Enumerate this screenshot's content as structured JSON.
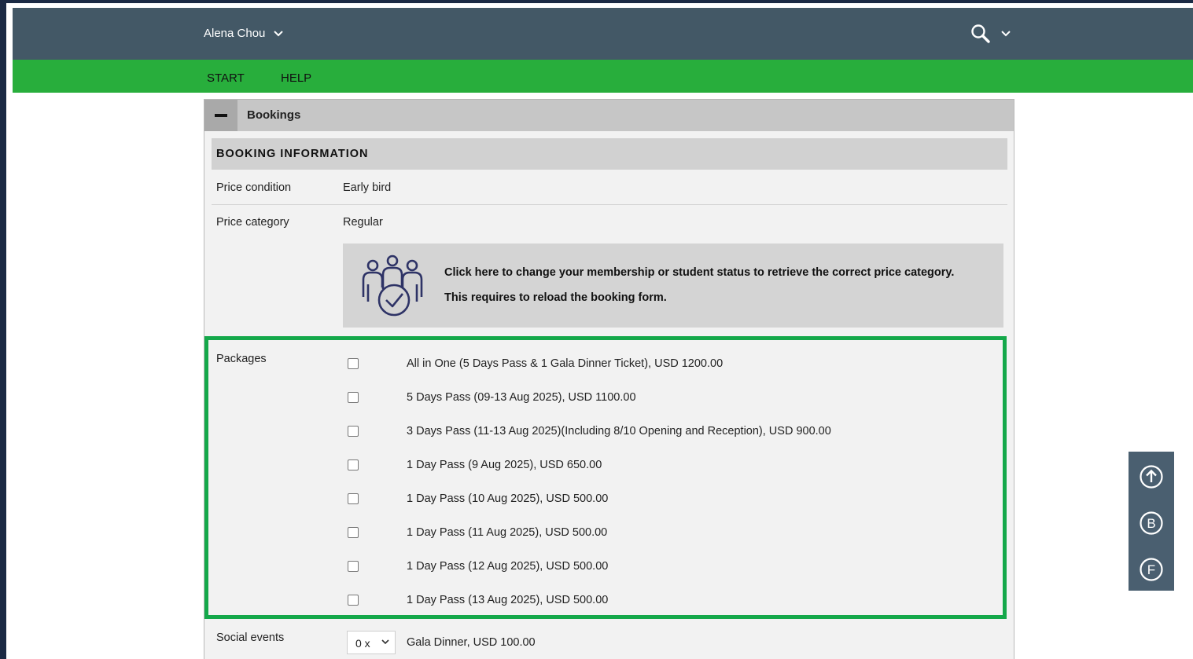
{
  "header": {
    "user_name": "Alena Chou",
    "user_dropdown_icon": "chevron-down-icon",
    "search_icon": "search-icon",
    "search_dropdown_icon": "chevron-down-icon"
  },
  "nav": {
    "items": [
      {
        "label": "START"
      },
      {
        "label": "HELP"
      }
    ]
  },
  "panel": {
    "title": "Bookings",
    "collapse_icon": "minus-icon",
    "section_title": "BOOKING INFORMATION",
    "price_condition": {
      "label": "Price condition",
      "value": "Early bird"
    },
    "price_category": {
      "label": "Price category",
      "value": "Regular"
    },
    "membership_notice": {
      "icon": "group-check-icon",
      "line1": "Click here to change your membership or student status to retrieve the correct price category.",
      "line2": "This requires to reload the booking form."
    },
    "packages": {
      "label": "Packages",
      "options": [
        {
          "label": "All in One (5 Days Pass & 1 Gala Dinner Ticket), USD 1200.00",
          "checked": false
        },
        {
          "label": "5 Days Pass (09-13 Aug 2025), USD 1100.00",
          "checked": false
        },
        {
          "label": "3 Days Pass (11-13 Aug 2025)(Including 8/10 Opening and Reception), USD 900.00",
          "checked": false
        },
        {
          "label": "1 Day Pass (9 Aug 2025), USD 650.00",
          "checked": false
        },
        {
          "label": "1 Day Pass (10 Aug 2025), USD 500.00",
          "checked": false
        },
        {
          "label": "1 Day Pass (11 Aug 2025), USD 500.00",
          "checked": false
        },
        {
          "label": "1 Day Pass (12 Aug 2025), USD 500.00",
          "checked": false
        },
        {
          "label": "1 Day Pass (13 Aug 2025), USD 500.00",
          "checked": false
        }
      ]
    },
    "social_events": {
      "label": "Social events",
      "quantity": "0 x",
      "item": "Gala Dinner, USD 100.00"
    }
  },
  "floating_toolbar": {
    "buttons": [
      {
        "icon": "arrow-up-circle-icon"
      },
      {
        "icon": "b-circle-icon",
        "glyph": "B"
      },
      {
        "icon": "f-circle-icon",
        "glyph": "F"
      }
    ]
  },
  "colors": {
    "topbar": "#435866",
    "navbar": "#28ae3c",
    "highlight": "#14a84a"
  }
}
